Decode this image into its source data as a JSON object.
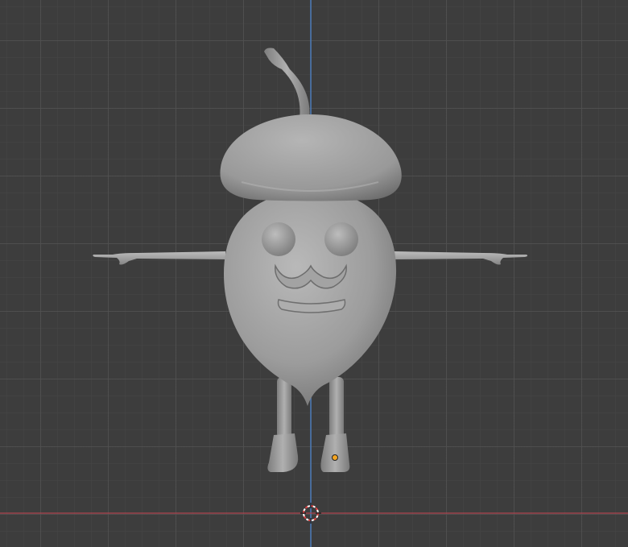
{
  "viewport": {
    "background_color": "#3d3d3d",
    "grid_major_color": "#505050",
    "grid_minor_color": "#464646",
    "x_axis_color": "#c0404a",
    "z_axis_color": "#4a7ab8"
  },
  "scene": {
    "object": "acorn-character",
    "shading": "solid-gray",
    "model_color": "#a6a6a6",
    "selection_origin_color": "#f5a623"
  },
  "icons": {
    "cursor": "3d-cursor-icon",
    "origin": "object-origin-icon"
  }
}
